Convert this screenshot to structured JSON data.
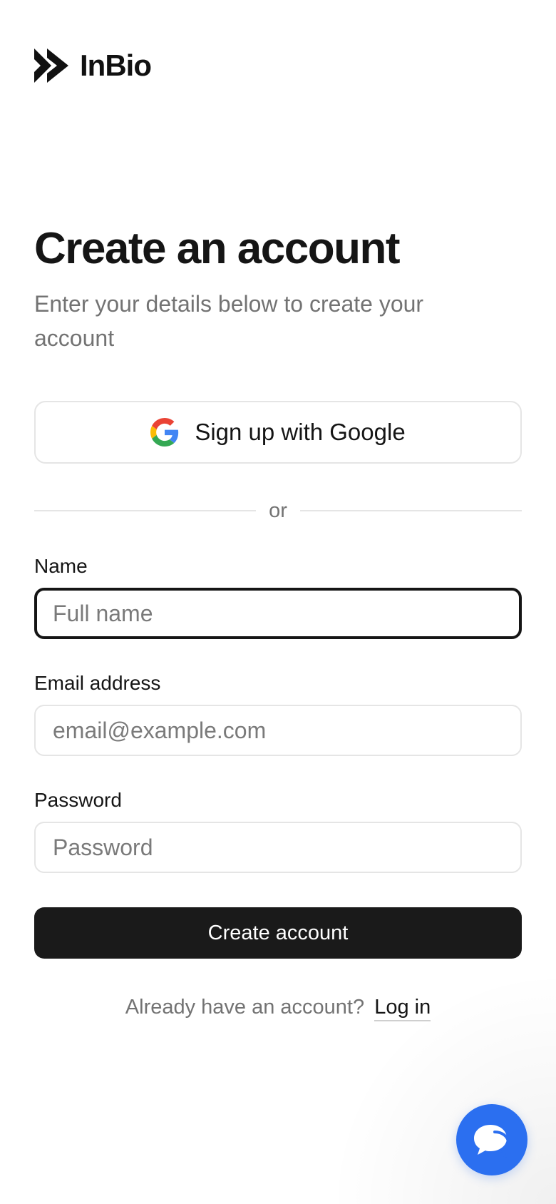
{
  "brand": {
    "name": "InBio",
    "logo_icon": "double-chevron-icon"
  },
  "header": {
    "title": "Create an account",
    "subtitle": "Enter your details below to create your account"
  },
  "google": {
    "label": "Sign up with Google",
    "icon": "google-icon"
  },
  "divider": {
    "text": "or"
  },
  "form": {
    "name": {
      "label": "Name",
      "placeholder": "Full name",
      "value": ""
    },
    "email": {
      "label": "Email address",
      "placeholder": "email@example.com",
      "value": ""
    },
    "password": {
      "label": "Password",
      "placeholder": "Password",
      "value": ""
    },
    "submit_label": "Create account"
  },
  "footer": {
    "prompt": "Already have an account?",
    "login_label": "Log in"
  },
  "chat": {
    "icon": "chat-bubble-icon",
    "color": "#2b6ff0"
  },
  "colors": {
    "primary": "#1a1a1a",
    "muted_text": "#737373",
    "border": "#e5e5e5",
    "chat_accent": "#2b6ff0"
  }
}
